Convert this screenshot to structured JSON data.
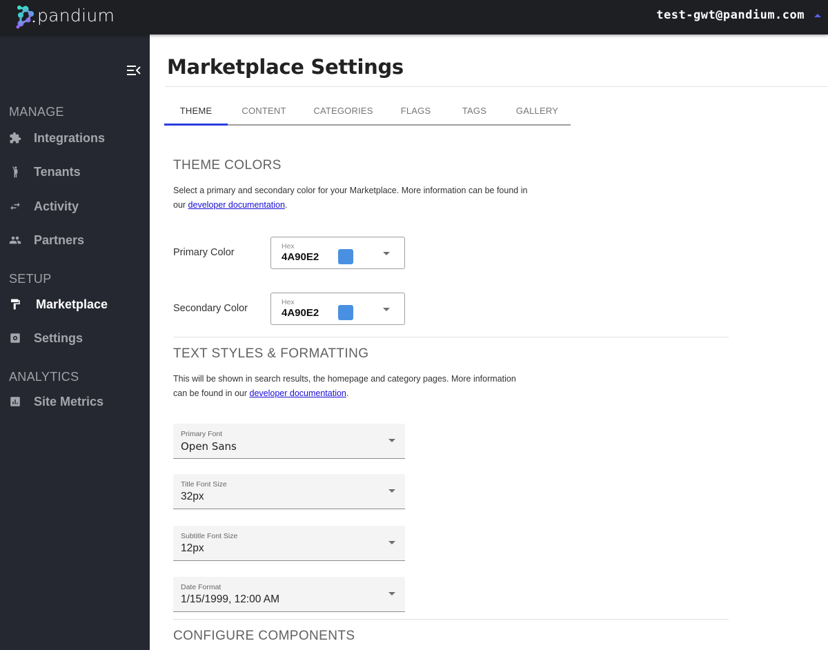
{
  "topbar": {
    "brand": "pandium",
    "user_email": "test-gwt@pandium.com"
  },
  "sidebar": {
    "sections": [
      {
        "label": "MANAGE"
      },
      {
        "label": "SETUP"
      },
      {
        "label": "ANALYTICS"
      }
    ],
    "items": [
      {
        "label": "Integrations",
        "icon": "puzzle-icon"
      },
      {
        "label": "Tenants",
        "icon": "person-waving-icon"
      },
      {
        "label": "Activity",
        "icon": "swap-arrows-icon"
      },
      {
        "label": "Partners",
        "icon": "people-icon"
      },
      {
        "label": "Marketplace",
        "icon": "paint-roller-icon",
        "active": true
      },
      {
        "label": "Settings",
        "icon": "settings-box-icon"
      },
      {
        "label": "Site Metrics",
        "icon": "bar-chart-icon"
      }
    ]
  },
  "page": {
    "title": "Marketplace Settings",
    "tabs": [
      {
        "label": "THEME",
        "active": true
      },
      {
        "label": "CONTENT"
      },
      {
        "label": "CATEGORIES"
      },
      {
        "label": "FLAGS"
      },
      {
        "label": "TAGS"
      },
      {
        "label": "GALLERY"
      }
    ]
  },
  "theme_colors": {
    "heading": "THEME COLORS",
    "description": "Select a primary and secondary color for your Marketplace. More information can be found in our ",
    "link": "developer documentation",
    "after_link": ".",
    "primary": {
      "label": "Primary Color",
      "caption": "Hex",
      "value": "4A90E2",
      "swatch": "#4A90E2"
    },
    "secondary": {
      "label": "Secondary Color",
      "caption": "Hex",
      "value": "4A90E2",
      "swatch": "#4A90E2"
    }
  },
  "text_styles": {
    "heading": "TEXT STYLES & FORMATTING",
    "description": "This will be shown in search results, the homepage and category pages. More information can be found in our ",
    "link": "developer documentation",
    "after_link": ".",
    "fields": [
      {
        "label": "Primary Font",
        "value": "Open Sans"
      },
      {
        "label": "Title Font Size",
        "value": "32px"
      },
      {
        "label": "Subtitle Font Size",
        "value": "12px"
      },
      {
        "label": "Date Format",
        "value": "1/15/1999, 12:00 AM"
      }
    ]
  },
  "configure_components": {
    "heading": "CONFIGURE COMPONENTS"
  }
}
